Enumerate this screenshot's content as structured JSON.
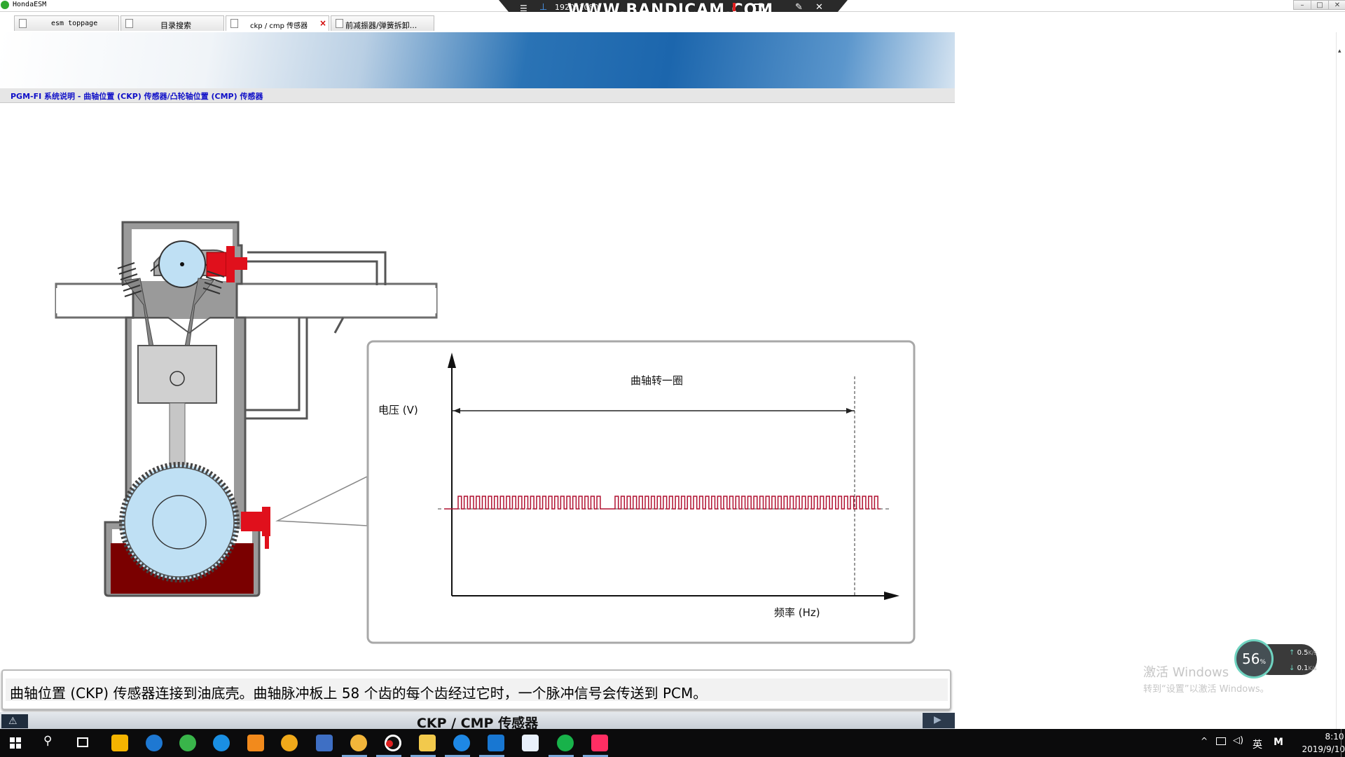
{
  "window": {
    "title": "HondaESM"
  },
  "recorder": {
    "logo": "WWW.BANDICAM.COM",
    "resolution": "1920x1080"
  },
  "tabs": [
    {
      "label": "esm toppage",
      "active": false
    },
    {
      "label": "目录搜索",
      "active": false
    },
    {
      "label": "ckp / cmp 传感器",
      "active": true,
      "close": "×"
    },
    {
      "label": "前减振器/弹簧拆卸...",
      "active": false
    }
  ],
  "breadcrumb": "PGM-FI 系统说明 - 曲轴位置 (CKP) 传感器/凸轮轴位置 (CMP) 传感器",
  "chart": {
    "ylabel": "电压 (V)",
    "xlabel": "频率 (Hz)",
    "span_label": "曲轴转一圈"
  },
  "chart_data": {
    "type": "line",
    "title": "",
    "xlabel": "频率 (Hz)",
    "ylabel": "电压 (V)",
    "annotation": "曲轴转一圈",
    "description_values": {
      "teeth_per_revolution": 58,
      "missing_teeth_gap": 2
    },
    "signal": "square-wave pulse train, one pulse per tooth, gap after 24 pulses"
  },
  "caption": "曲轴位置 (CKP) 传感器连接到油底壳。曲轴脉冲板上 58 个齿的每个齿经过它时，一个脉冲信号会传送到 PCM。",
  "footer": {
    "title": "CKP / CMP 传感器"
  },
  "watermark": {
    "line1": "激活 Windows",
    "line2": "转到“设置”以激活 Windows。"
  },
  "speed_widget": {
    "percent": "56",
    "percent_unit": "%",
    "up": "0.5",
    "down": "0.1",
    "unit": "K/s"
  },
  "taskbar": {
    "ime": "英",
    "m": "M",
    "time": "8:10",
    "date": "2019/9/10"
  },
  "colors": {
    "sensor_red": "#e0101c",
    "oil": "#7a0000",
    "engine_blue": "#bfe0f4",
    "waveform": "#b01030"
  }
}
